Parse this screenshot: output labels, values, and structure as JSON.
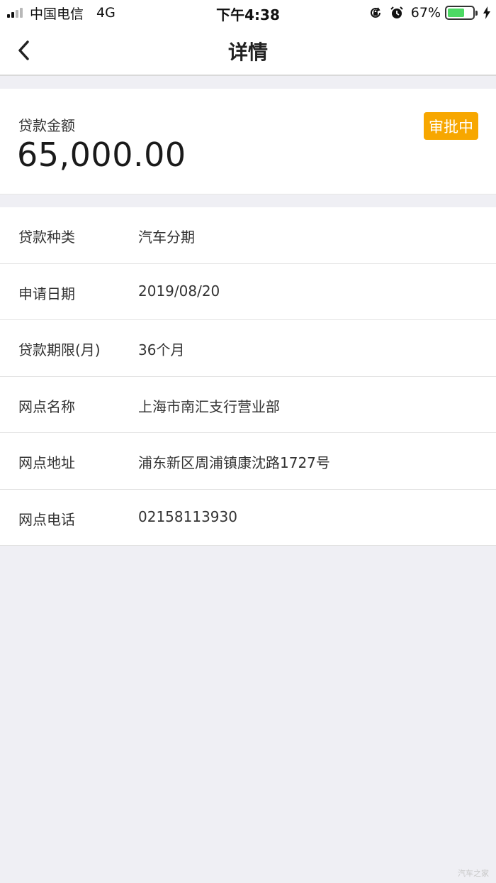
{
  "status_bar": {
    "carrier": "中国电信",
    "network": "4G",
    "time": "下午4:38",
    "battery_percent": "67%",
    "battery_level": 0.67,
    "icons": [
      "signal-icon",
      "rotation-lock-icon",
      "alarm-icon",
      "battery-icon",
      "charging-icon"
    ]
  },
  "nav": {
    "title": "详情",
    "back_icon": "chevron-left-icon"
  },
  "loan": {
    "amount_label": "贷款金额",
    "amount_value": "65,000.00",
    "status": "审批中",
    "status_color": "#f7a700"
  },
  "details": [
    {
      "label": "贷款种类",
      "value": "汽车分期"
    },
    {
      "label": "申请日期",
      "value": "2019/08/20"
    },
    {
      "label": "贷款期限(月)",
      "value": "36个月"
    },
    {
      "label": "网点名称",
      "value": "上海市南汇支行营业部"
    },
    {
      "label": "网点地址",
      "value": "浦东新区周浦镇康沈路1727号"
    },
    {
      "label": "网点电话",
      "value": "02158113930"
    }
  ],
  "watermark": "汽车之家"
}
